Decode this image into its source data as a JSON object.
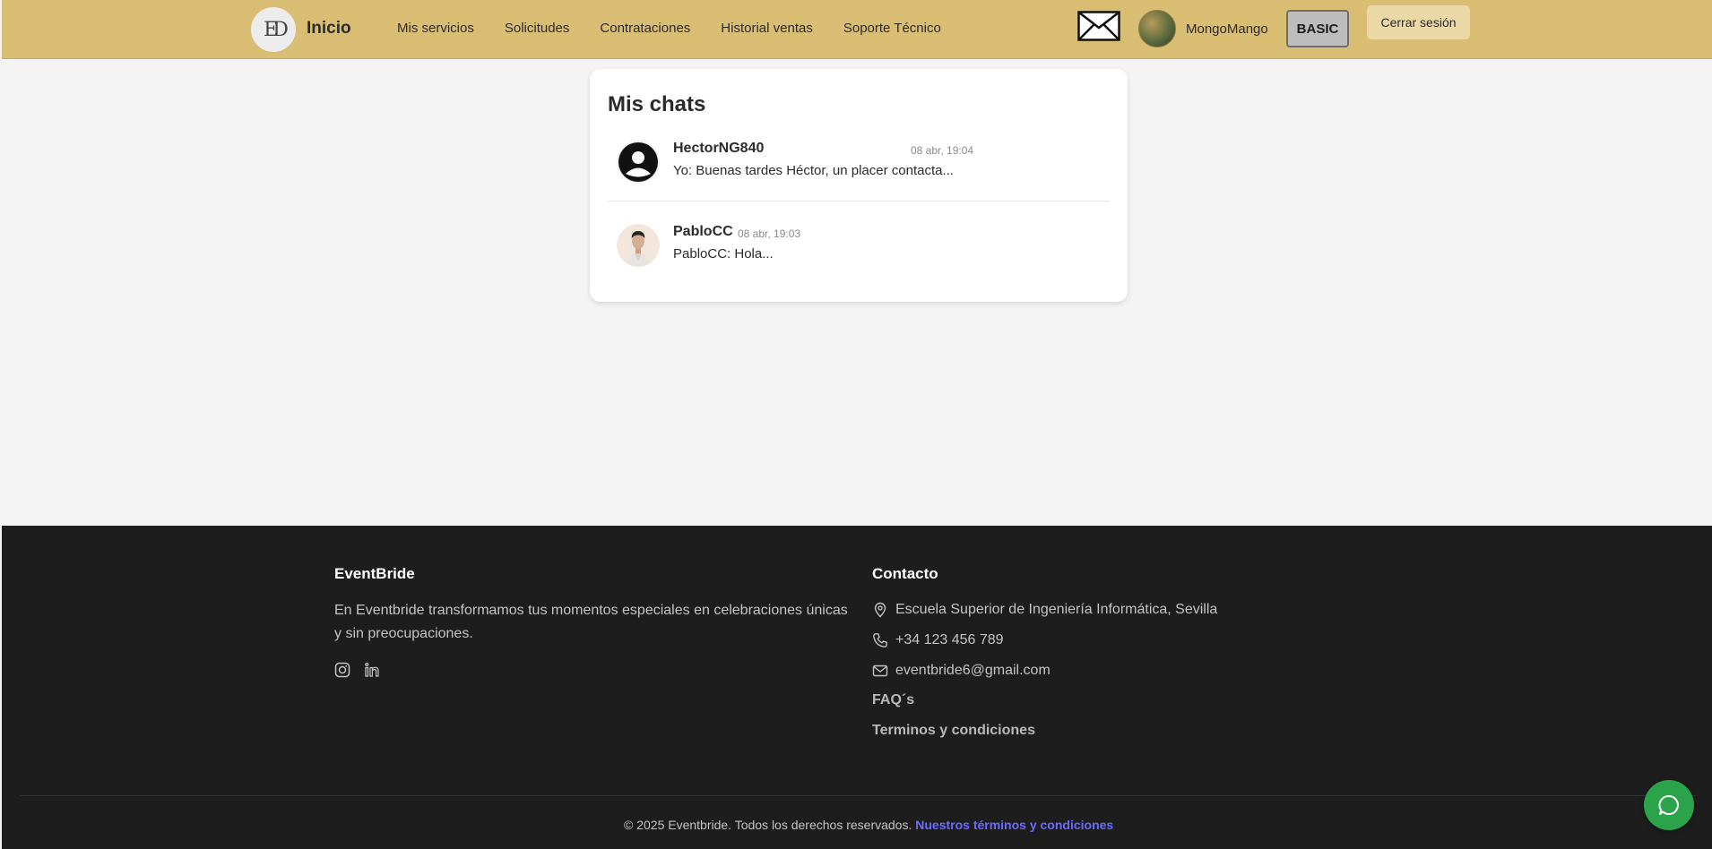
{
  "header": {
    "logo_text": "ED",
    "brand": "Inicio",
    "nav": [
      "Mis servicios",
      "Solicitudes",
      "Contrataciones",
      "Historial ventas",
      "Soporte Técnico"
    ],
    "username": "MongoMango",
    "plan_badge": "BASIC",
    "logout_label": "Cerrar sesión"
  },
  "chats": {
    "title": "Mis chats",
    "items": [
      {
        "name": "HectorNG840",
        "time": "08 abr, 19:04",
        "preview": "Yo:  Buenas tardes Héctor, un placer contacta..."
      },
      {
        "name": "PabloCC",
        "time": "08 abr, 19:03",
        "preview": "PabloCC:  Hola..."
      }
    ]
  },
  "footer": {
    "brand_title": "EventBride",
    "brand_desc_1": "En Eventbride transformamos tus momentos especiales en celebraciones únicas",
    "brand_desc_2": "y sin preocupaciones.",
    "contact_title": "Contacto",
    "address": "Escuela Superior de Ingeniería Informática, Sevilla",
    "phone": "+34 123 456 789",
    "email": "eventbride6@gmail.com",
    "faq": "FAQ´s",
    "terms": "Terminos y condiciones",
    "copyright": "© 2025 Eventbride. Todos los derechos reservados.",
    "copyright_link": "Nuestros términos y condiciones"
  },
  "colors": {
    "header_bg": "#d9bd73",
    "footer_bg": "#1d1d1d",
    "fab_bg": "#2aa34a",
    "link_accent": "#6b6bff"
  }
}
